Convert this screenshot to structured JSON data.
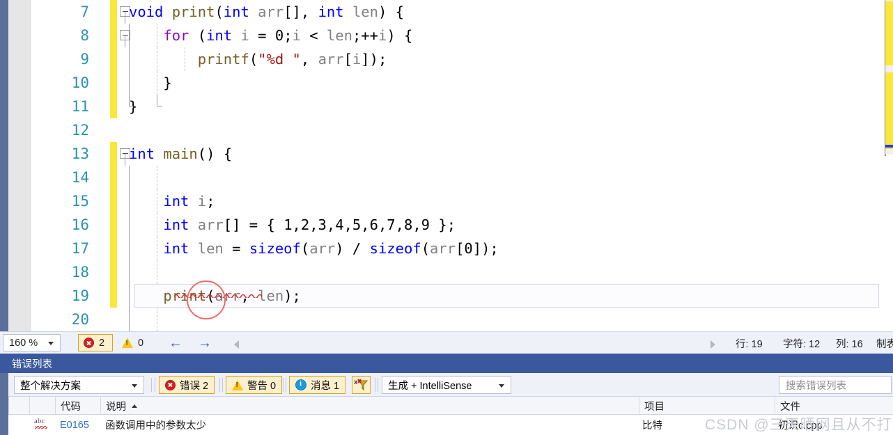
{
  "editor": {
    "language": "cpp",
    "current_line": 19,
    "lines": [
      {
        "num": "7",
        "changed": true,
        "text": "void print(int arr[], int len) {"
      },
      {
        "num": "8",
        "changed": true,
        "text": "    for (int i = 0;i < len;++i) {"
      },
      {
        "num": "9",
        "changed": true,
        "text": "        printf(\"%d \", arr[i]);"
      },
      {
        "num": "10",
        "changed": true,
        "text": "    }"
      },
      {
        "num": "11",
        "changed": true,
        "text": "}"
      },
      {
        "num": "12",
        "changed": false,
        "text": ""
      },
      {
        "num": "13",
        "changed": true,
        "text": "int main() {"
      },
      {
        "num": "14",
        "changed": true,
        "text": ""
      },
      {
        "num": "15",
        "changed": true,
        "text": "    int i;"
      },
      {
        "num": "16",
        "changed": true,
        "text": "    int arr[] = { 1,2,3,4,5,6,7,8,9 };"
      },
      {
        "num": "17",
        "changed": true,
        "text": "    int len = sizeof(arr) / sizeof(arr[0]);"
      },
      {
        "num": "18",
        "changed": true,
        "text": ""
      },
      {
        "num": "19",
        "changed": true,
        "text": "    print(arr, len);"
      },
      {
        "num": "20",
        "changed": false,
        "text": ""
      }
    ],
    "tokens": {
      "l7": [
        [
          "kw",
          "void"
        ],
        [
          "pl",
          " "
        ],
        [
          "fn",
          "print"
        ],
        [
          "pl",
          "("
        ],
        [
          "kw",
          "int"
        ],
        [
          "pl",
          " "
        ],
        [
          "id",
          "arr"
        ],
        [
          "pl",
          "[], "
        ],
        [
          "kw",
          "int"
        ],
        [
          "pl",
          " "
        ],
        [
          "id",
          "len"
        ],
        [
          "pl",
          ") {"
        ]
      ],
      "l8": [
        [
          "pl",
          "    "
        ],
        [
          "kw2",
          "for"
        ],
        [
          "pl",
          " ("
        ],
        [
          "kw",
          "int"
        ],
        [
          "pl",
          " "
        ],
        [
          "id",
          "i"
        ],
        [
          "pl",
          " = "
        ],
        [
          "num",
          "0"
        ],
        [
          "pl",
          ";"
        ],
        [
          "id",
          "i"
        ],
        [
          "pl",
          " < "
        ],
        [
          "id",
          "len"
        ],
        [
          "pl",
          ";++"
        ],
        [
          "id",
          "i"
        ],
        [
          "pl",
          ") {"
        ]
      ],
      "l9": [
        [
          "pl",
          "        "
        ],
        [
          "fn",
          "printf"
        ],
        [
          "pl",
          "("
        ],
        [
          "str",
          "\"%d \""
        ],
        [
          "pl",
          ", "
        ],
        [
          "id",
          "arr"
        ],
        [
          "pl",
          "["
        ],
        [
          "id",
          "i"
        ],
        [
          "pl",
          "]);"
        ]
      ],
      "l10": [
        [
          "pl",
          "    }"
        ]
      ],
      "l11": [
        [
          "pl",
          "}"
        ]
      ],
      "l13": [
        [
          "kw",
          "int"
        ],
        [
          "pl",
          " "
        ],
        [
          "fn",
          "main"
        ],
        [
          "pl",
          "() {"
        ]
      ],
      "l15": [
        [
          "pl",
          "    "
        ],
        [
          "kw",
          "int"
        ],
        [
          "pl",
          " "
        ],
        [
          "id",
          "i"
        ],
        [
          "pl",
          ";"
        ]
      ],
      "l16": [
        [
          "pl",
          "    "
        ],
        [
          "kw",
          "int"
        ],
        [
          "pl",
          " "
        ],
        [
          "id",
          "arr"
        ],
        [
          "pl",
          "[] = { "
        ],
        [
          "num",
          "1,2,3,4,5,6,7,8,9"
        ],
        [
          "pl",
          " };"
        ]
      ],
      "l17": [
        [
          "pl",
          "    "
        ],
        [
          "kw",
          "int"
        ],
        [
          "pl",
          " "
        ],
        [
          "id",
          "len"
        ],
        [
          "pl",
          " = "
        ],
        [
          "kw",
          "sizeof"
        ],
        [
          "pl",
          "("
        ],
        [
          "id",
          "arr"
        ],
        [
          "pl",
          ") / "
        ],
        [
          "kw",
          "sizeof"
        ],
        [
          "pl",
          "("
        ],
        [
          "id",
          "arr"
        ],
        [
          "pl",
          "["
        ],
        [
          "num",
          "0"
        ],
        [
          "pl",
          "]);"
        ]
      ],
      "l19": [
        [
          "pl",
          "    "
        ],
        [
          "fn",
          "print"
        ],
        [
          "pl",
          "("
        ],
        [
          "id",
          "arr"
        ],
        [
          "pl",
          ", "
        ],
        [
          "id",
          "len"
        ],
        [
          "pl",
          ");"
        ]
      ]
    },
    "colors": {
      "keyword": "#0000ff",
      "control_keyword": "#8f08c4",
      "function": "#795e26",
      "identifier": "#808080",
      "string": "#a31515",
      "line_number": "#2b91af",
      "change_bar": "#fbe73c",
      "error_squiggle": "#e03030",
      "annotation_circle": "#f06a6a"
    }
  },
  "statusbar": {
    "zoom": "160 %",
    "error_count": "2",
    "warning_count": "0",
    "back_arrow": "←",
    "forward_arrow": "→",
    "line_label": "行: 19",
    "char_label": "字符: 12",
    "col_label": "列: 16",
    "tab_label": "制表"
  },
  "error_list": {
    "title": "错误列表",
    "scope": "整个解决方案",
    "errors_toggle": "错误 2",
    "warnings_toggle": "警告 0",
    "messages_toggle": "消息 1",
    "build_filter": "生成 + IntelliSense",
    "search_placeholder": "搜索错误列表",
    "columns": [
      "代码",
      "说明",
      "项目",
      "文件"
    ],
    "rows": [
      {
        "icon": "intellisense-error-icon",
        "code": "E0165",
        "description": "函数调用中的参数太少",
        "project": "比特",
        "file": "初识c.cpp"
      }
    ]
  },
  "watermark": {
    "text": "CSDN @三天晒网且从不打鱼"
  }
}
